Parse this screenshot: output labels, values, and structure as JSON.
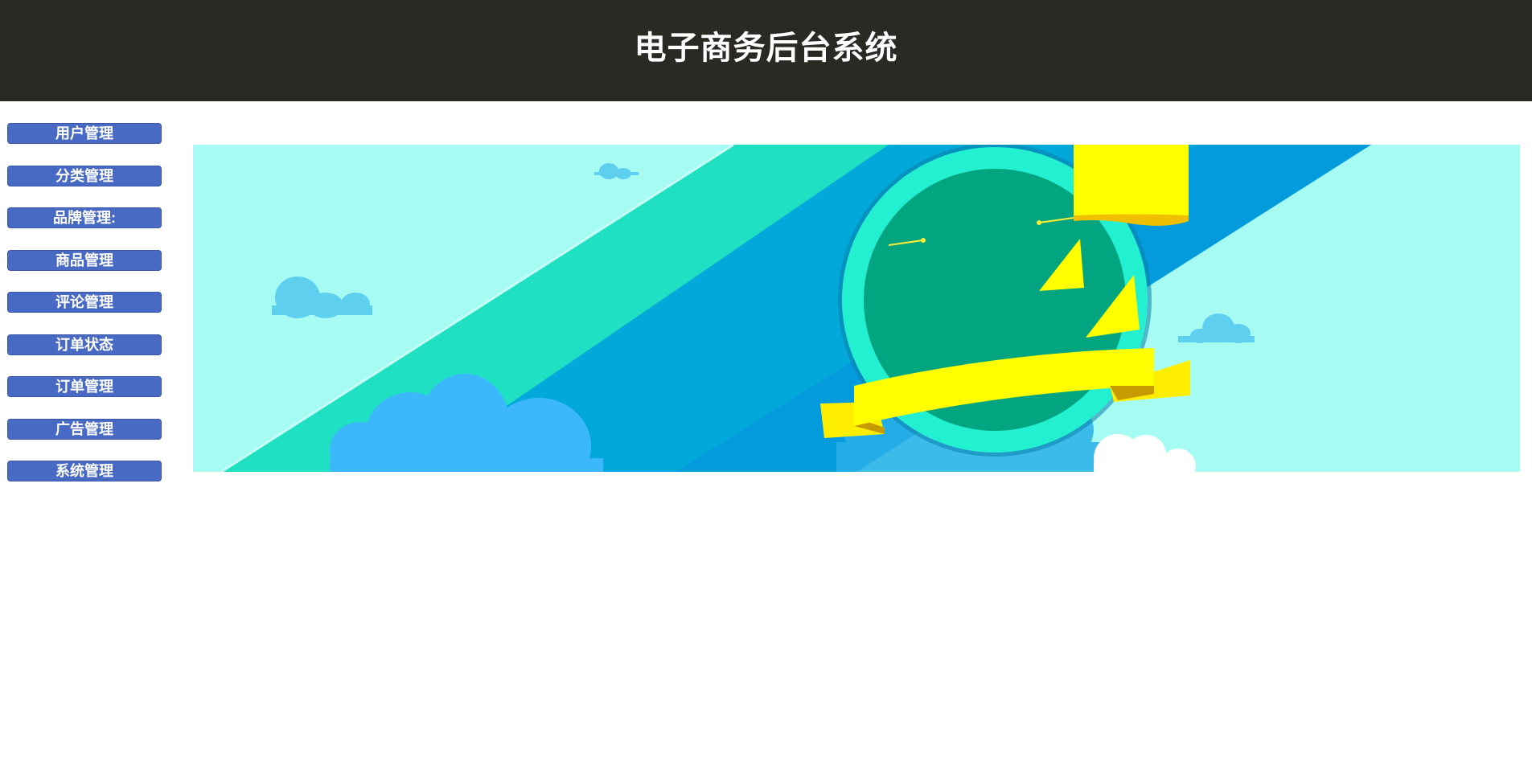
{
  "header": {
    "title": "电子商务后台系统"
  },
  "sidebar": {
    "items": [
      {
        "label": "用户管理"
      },
      {
        "label": "分类管理"
      },
      {
        "label": "品牌管理:"
      },
      {
        "label": "商品管理"
      },
      {
        "label": "评论管理"
      },
      {
        "label": "订单状态"
      },
      {
        "label": "订单管理"
      },
      {
        "label": "广告管理"
      },
      {
        "label": "系统管理"
      }
    ]
  },
  "colors": {
    "header_bg": "#2a2924",
    "nav_button": "#4869c4",
    "banner_sky": "#a6fbf3",
    "banner_stripe_teal": "#1fe0c3",
    "banner_stripe_blue": "#02a8d9",
    "badge_green": "#02a57f",
    "ribbon_yellow": "#ffff00"
  },
  "banner": {
    "icon": "promo-banner-image"
  }
}
